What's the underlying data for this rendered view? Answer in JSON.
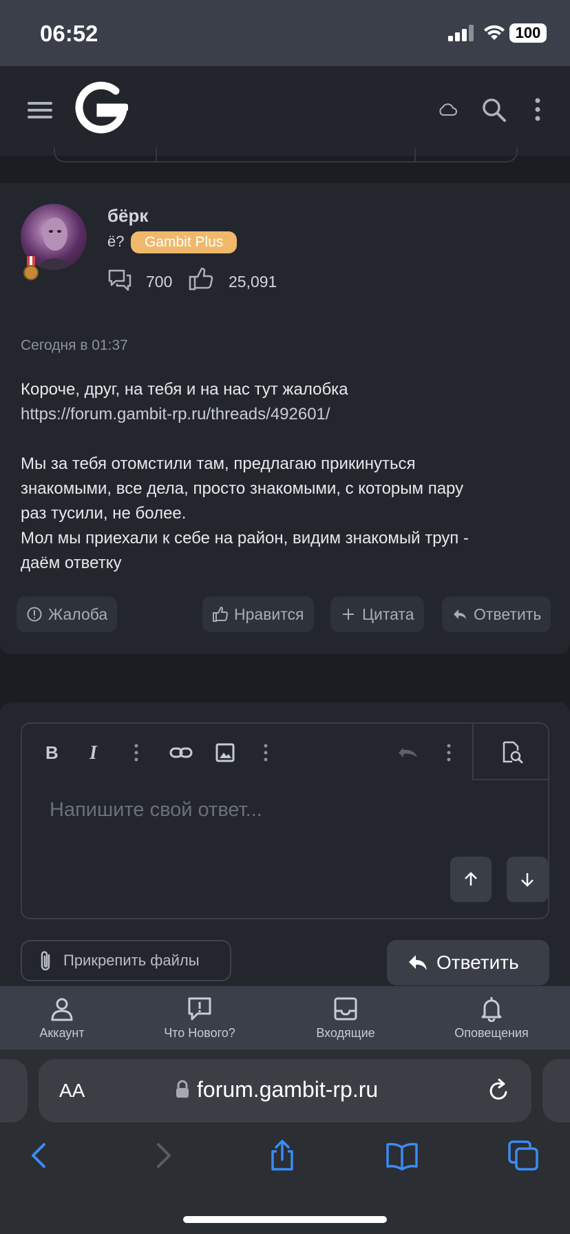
{
  "status_bar": {
    "time": "06:52",
    "battery": "100"
  },
  "header": {
    "logo": "G-logo",
    "icons": [
      "menu-icon",
      "cloud-icon",
      "search-icon",
      "more-icon"
    ]
  },
  "post": {
    "username": "бёрк",
    "user_title": "ё?",
    "badge": "Gambit Plus",
    "badge_color": "#f0b86b",
    "messages_count": "700",
    "likes_count": "25,091",
    "date": "Сегодня в 01:37",
    "body_line1": "Короче, друг, на тебя и на нас тут жалобка",
    "link": "https://forum.gambit-rp.ru/threads/492601/",
    "body_rest": "Мы за тебя отомстили там, предлагаю прикинуться\nзнакомыми, все дела, просто знакомыми, с которым пару\nраз тусили, не более.\nМол мы приехали к себе на район, видим знакомый труп -\nдаём ответку",
    "actions": {
      "report": "Жалоба",
      "like": "Нравится",
      "quote": "Цитата",
      "reply": "Ответить"
    }
  },
  "editor": {
    "placeholder": "Напишите свой ответ...",
    "attach_label": "Прикрепить файлы",
    "submit_label": "Ответить"
  },
  "tabs": [
    {
      "label": "Аккаунт",
      "icon": "user-icon"
    },
    {
      "label": "Что Нового?",
      "icon": "alert-message-icon"
    },
    {
      "label": "Входящие",
      "icon": "inbox-icon"
    },
    {
      "label": "Оповещения",
      "icon": "bell-icon"
    }
  ],
  "browser": {
    "aa": "AA",
    "url": "forum.gambit-rp.ru"
  }
}
